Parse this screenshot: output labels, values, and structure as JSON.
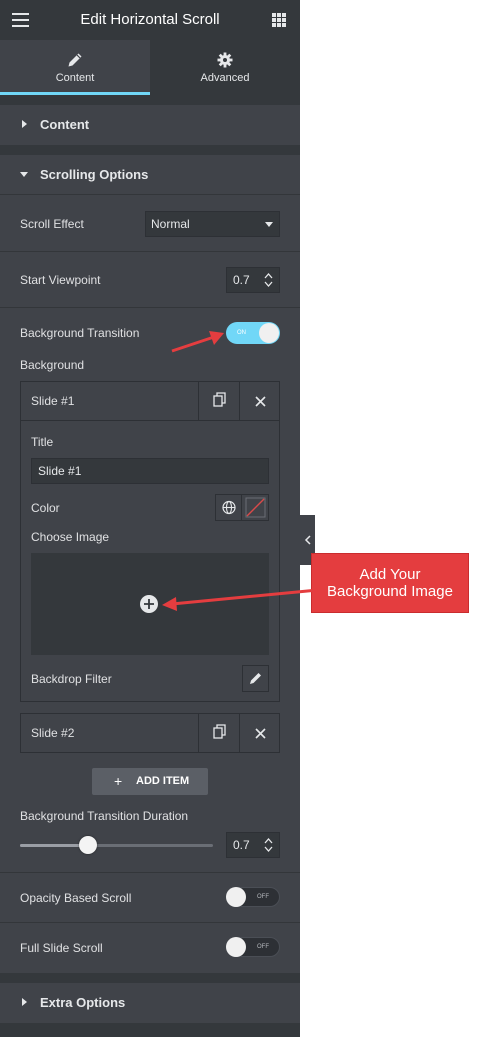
{
  "header": {
    "title": "Edit Horizontal Scroll"
  },
  "tabs": [
    {
      "label": "Content"
    },
    {
      "label": "Advanced"
    }
  ],
  "sections": {
    "content": {
      "label": "Content"
    },
    "scrolling": {
      "label": "Scrolling Options"
    },
    "extra": {
      "label": "Extra Options"
    }
  },
  "controls": {
    "scroll_effect": {
      "label": "Scroll Effect",
      "value": "Normal"
    },
    "start_viewpoint": {
      "label": "Start Viewpoint",
      "value": "0.7"
    },
    "background_transition": {
      "label": "Background Transition",
      "state": "ON"
    },
    "background": {
      "label": "Background"
    },
    "transition_duration": {
      "label": "Background Transition Duration",
      "value": "0.7",
      "slider_fraction": 0.35
    },
    "opacity_scroll": {
      "label": "Opacity Based Scroll",
      "state": "OFF"
    },
    "full_slide_scroll": {
      "label": "Full Slide Scroll",
      "state": "OFF"
    }
  },
  "repeater": {
    "items": [
      {
        "title": "Slide #1"
      },
      {
        "title": "Slide #2"
      }
    ],
    "fields": {
      "title_label": "Title",
      "title_value": "Slide #1",
      "color_label": "Color",
      "image_label": "Choose Image",
      "backdrop_label": "Backdrop Filter"
    },
    "add_label": "ADD ITEM"
  },
  "annotation": {
    "line1": "Add Your",
    "line2": "Background Image"
  },
  "colors": {
    "panel": "#404349",
    "dark": "#34383c",
    "accent": "#71d7f7",
    "callout": "#e43d3f"
  },
  "icons": [
    "hamburger-icon",
    "apps-grid-icon",
    "pencil-icon",
    "gear-icon",
    "copy-icon",
    "close-icon",
    "globe-icon",
    "plus-icon",
    "chevron-left-icon"
  ]
}
